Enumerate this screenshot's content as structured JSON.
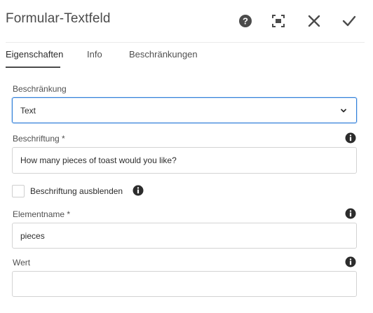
{
  "dialog": {
    "title": "Formular-Textfeld",
    "actions": {
      "help": "help-icon",
      "fullscreen": "fullscreen-icon",
      "close": "close-icon",
      "confirm": "checkmark-icon"
    }
  },
  "tabs": [
    {
      "label": "Eigenschaften",
      "active": true
    },
    {
      "label": "Info",
      "active": false
    },
    {
      "label": "Beschränkungen",
      "active": false
    }
  ],
  "form": {
    "constraint": {
      "label": "Beschränkung",
      "value": "Text"
    },
    "caption": {
      "label": "Beschriftung *",
      "value": "How many pieces of toast would you like?"
    },
    "hide_caption": {
      "label": "Beschriftung ausblenden",
      "checked": false
    },
    "element_name": {
      "label": "Elementname *",
      "value": "pieces"
    },
    "value": {
      "label": "Wert",
      "value": ""
    }
  },
  "colors": {
    "accent": "#2f7ed8",
    "text": "#2c2c2c",
    "icon": "#4b4b4b"
  }
}
